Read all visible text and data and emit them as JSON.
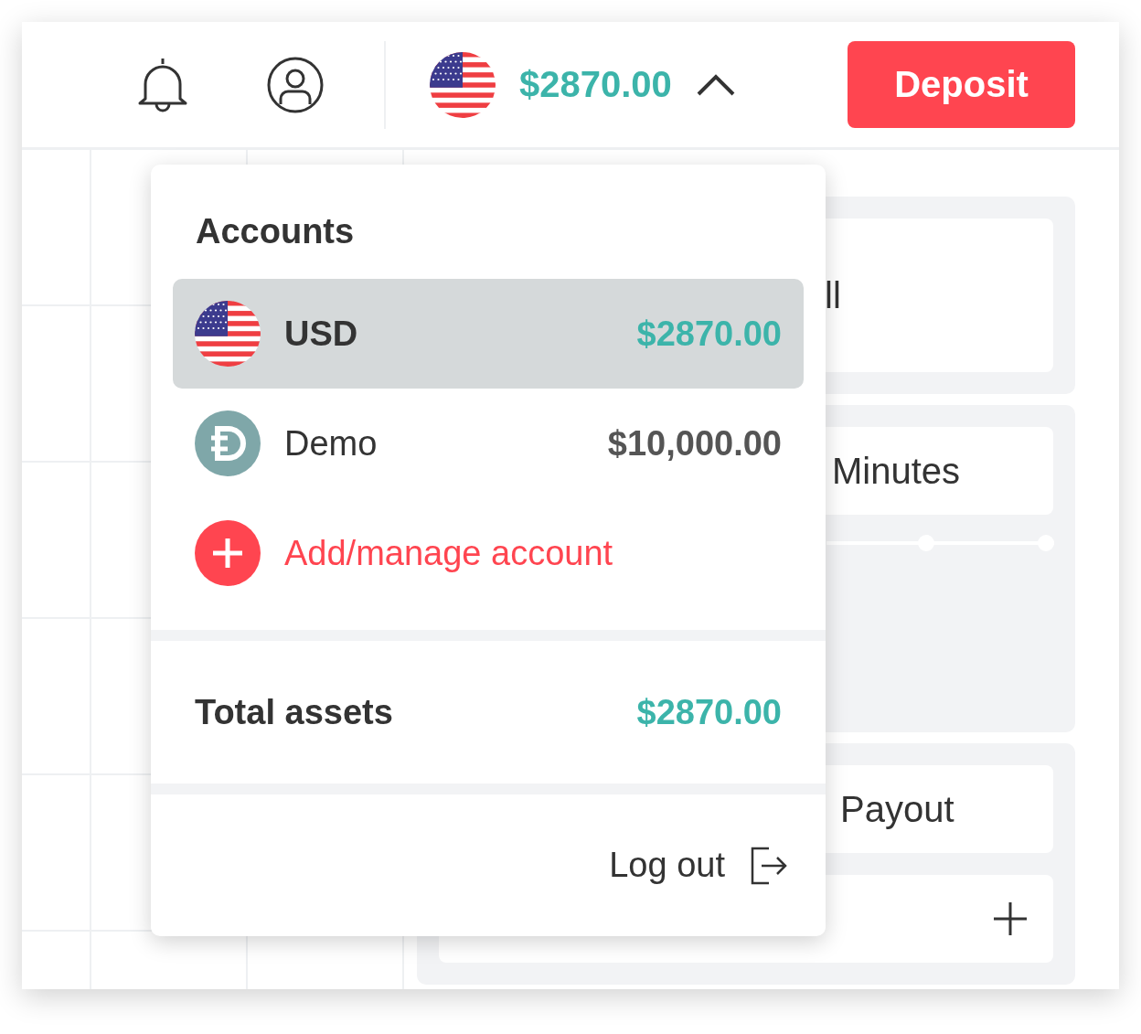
{
  "header": {
    "balance": "$2870.00",
    "menu_expanded": true,
    "deposit_button": "Deposit"
  },
  "background_cards": [
    {
      "text": "ll",
      "kind": "text"
    },
    {
      "text": "Minutes",
      "kind": "slider"
    },
    {
      "text": "Payout",
      "kind": "stepper"
    }
  ],
  "account_menu": {
    "title": "Accounts",
    "accounts": [
      {
        "kind": "usd",
        "name": "USD",
        "balance": "$2870.00",
        "selected": true
      },
      {
        "kind": "demo",
        "name": "Demo",
        "balance": "$10,000.00",
        "selected": false
      }
    ],
    "add_account": "Add/manage account",
    "total_label": "Total assets",
    "total_value": "$2870.00",
    "logout": "Log out"
  }
}
